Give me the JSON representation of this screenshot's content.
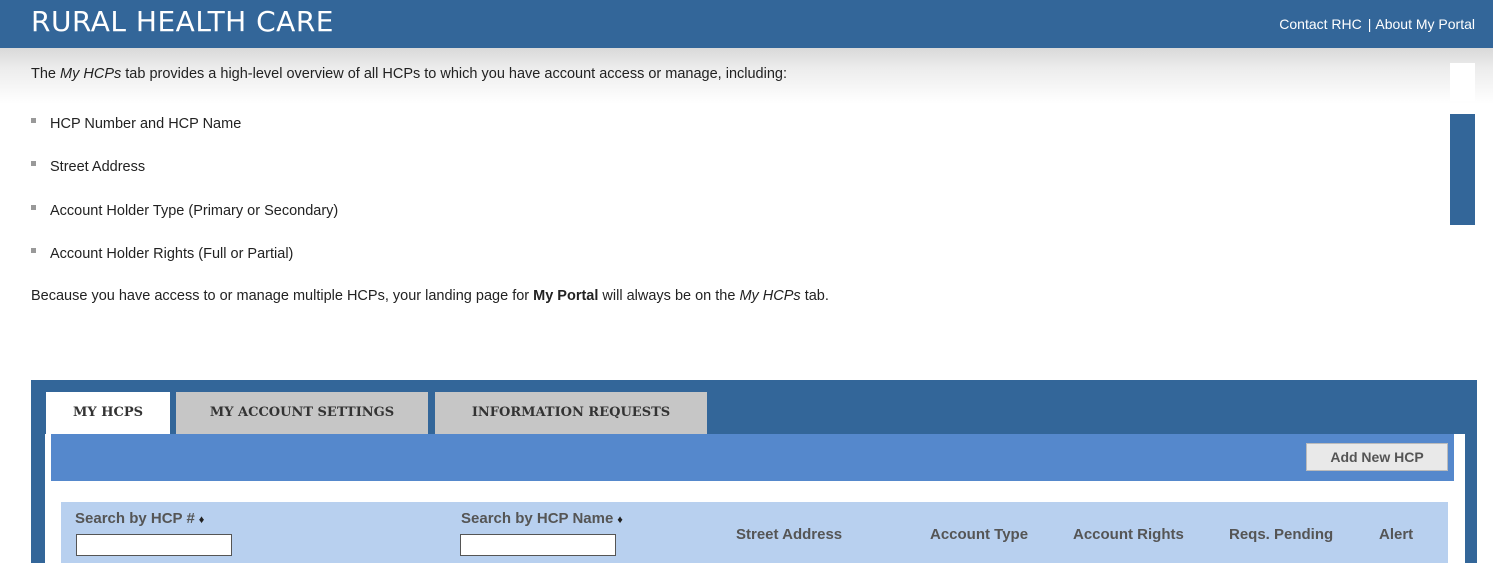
{
  "header": {
    "brand": "RURAL HEALTH CARE",
    "links": [
      "Contact RHC",
      "About My Portal"
    ],
    "separator": "|"
  },
  "intro": {
    "line_pre": "The ",
    "line_em": "My HCPs",
    "line_post": " tab provides a high-level overview of all HCPs to which you have account access or manage, including:",
    "bullets": [
      "HCP Number and HCP Name",
      "Street Address",
      "Account Holder Type (Primary or Secondary)",
      "Account Holder Rights (Full or Partial)"
    ],
    "outro_pre": "Because you have access to or manage multiple HCPs, your landing page for ",
    "outro_bold": "My Portal",
    "outro_mid": " will always be on the ",
    "outro_em": "My HCPs",
    "outro_post": " tab."
  },
  "tabs": [
    {
      "label": "MY HCPS",
      "active": true
    },
    {
      "label": "MY ACCOUNT SETTINGS",
      "active": false
    },
    {
      "label": "INFORMATION REQUESTS",
      "active": false
    }
  ],
  "toolbar": {
    "add_label": "Add New HCP"
  },
  "table": {
    "columns": [
      "Search by HCP #",
      "Search by HCP Name",
      "Street Address",
      "Account Type",
      "Account Rights",
      "Reqs. Pending",
      "Alert"
    ],
    "sort_glyph": "♦",
    "search_hcp_number_value": "",
    "search_hcp_name_value": ""
  },
  "colors": {
    "brand_blue": "#336699",
    "toolbar_blue": "#5588cc",
    "table_header": "#b8d0ef"
  }
}
